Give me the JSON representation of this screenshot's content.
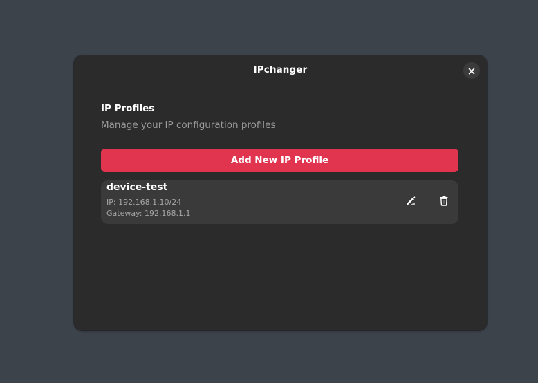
{
  "window": {
    "title": "IPchanger"
  },
  "section": {
    "title": "IP Profiles",
    "subtitle": "Manage your IP configuration profiles"
  },
  "actions": {
    "add_label": "Add New IP Profile"
  },
  "profiles": [
    {
      "name": "device-test",
      "ip": "IP: 192.168.1.10/24",
      "gateway": "Gateway: 192.168.1.1"
    }
  ],
  "icons": {
    "close": "close-icon",
    "edit": "edit-icon",
    "delete": "trash-icon"
  },
  "colors": {
    "accent": "#e0344f",
    "background": "#3d434b",
    "window": "#2b2b2b",
    "card": "#3a3a3a"
  }
}
